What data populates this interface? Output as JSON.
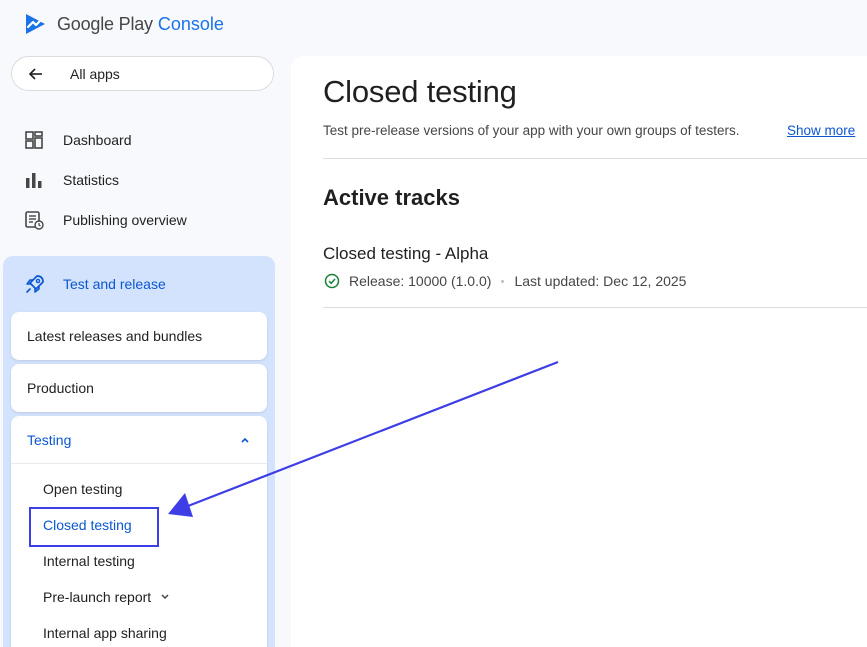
{
  "brand": {
    "google": "Google Play",
    "console": "Console",
    "icon": "play-console-logo"
  },
  "sidebar": {
    "all_apps": {
      "label": "All apps",
      "icon": "arrow-left-icon"
    },
    "items": [
      {
        "label": "Dashboard",
        "icon": "dashboard-icon"
      },
      {
        "label": "Statistics",
        "icon": "bar-chart-icon"
      },
      {
        "label": "Publishing overview",
        "icon": "publishing-overview-icon"
      }
    ],
    "section": {
      "label": "Test and release",
      "icon": "rocket-icon"
    },
    "cards": [
      {
        "label": "Latest releases and bundles"
      },
      {
        "label": "Production"
      }
    ],
    "testing": {
      "label": "Testing",
      "expanded_icon": "chevron-up-icon",
      "items": [
        {
          "label": "Open testing"
        },
        {
          "label": "Closed testing",
          "active": true
        },
        {
          "label": "Internal testing"
        },
        {
          "label": "Pre-launch report",
          "icon": "chevron-down-icon"
        },
        {
          "label": "Internal app sharing"
        }
      ]
    }
  },
  "main": {
    "title": "Closed testing",
    "subtitle": "Test pre-release versions of your app with your own groups of testers.",
    "show_more": "Show more",
    "section_title": "Active tracks",
    "track": {
      "name": "Closed testing - Alpha",
      "release": "Release: 10000 (1.0.0)",
      "last_updated": "Last updated: Dec 12, 2025",
      "status_icon": "check-circle-icon"
    }
  },
  "annotation": {
    "color": "#3e3ee6"
  },
  "colors": {
    "accent": "#0b57d0",
    "section_bg": "#d3e3fd",
    "success": "#188038"
  }
}
